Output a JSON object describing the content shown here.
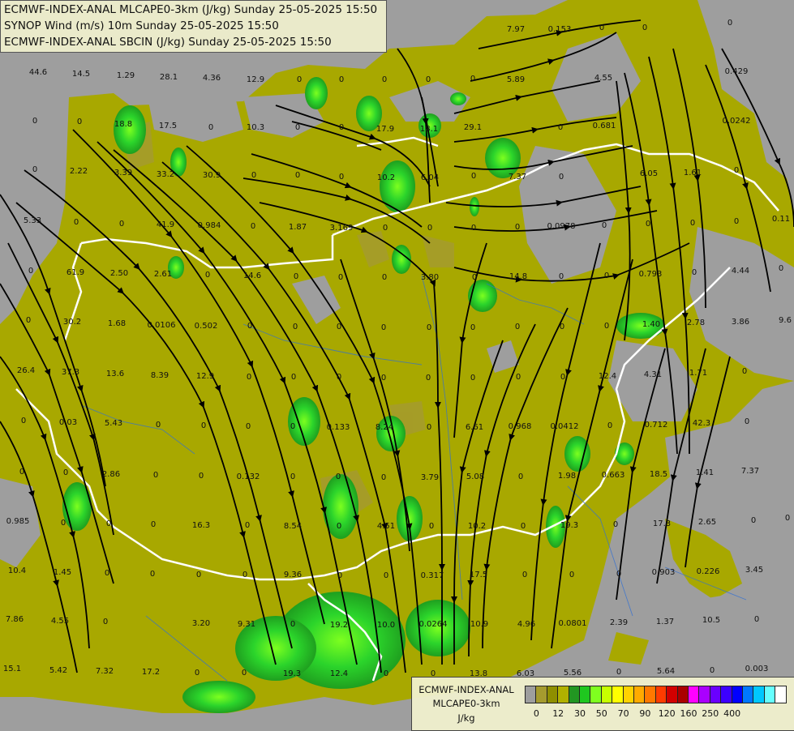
{
  "titles": [
    "ECMWF-INDEX-ANAL MLCAPE0-3km (J/kg) Sunday 25-05-2025 15:50",
    "SYNOP Wind (m/s) 10m Sunday 25-05-2025 15:50",
    "ECMWF-INDEX-ANAL SBCIN (J/kg) Sunday 25-05-2025 15:50"
  ],
  "legend": {
    "line1": "ECMWF-INDEX-ANAL",
    "line2": "MLCAPE0-3km",
    "unit": "J/kg",
    "colors": [
      "#9e9e9e",
      "#a59b2e",
      "#8f8f00",
      "#b1b100",
      "#229622",
      "#1fc71f",
      "#7fff1f",
      "#c7ff00",
      "#ffff00",
      "#ffd200",
      "#ffaa00",
      "#ff7800",
      "#ff3c00",
      "#d20000",
      "#aa0000",
      "#ff00ff",
      "#aa00ff",
      "#6a00ff",
      "#3c00ff",
      "#0000ff",
      "#0078ff",
      "#00c8ff",
      "#66ffff",
      "#ffffff"
    ],
    "ticks": [
      "0",
      "12",
      "30",
      "50",
      "70",
      "90",
      "120",
      "160",
      "250",
      "400"
    ]
  },
  "values": [
    [
      "44.6",
      47,
      92
    ],
    [
      "14.5",
      100,
      94
    ],
    [
      "1.29",
      155,
      96
    ],
    [
      "28.1",
      208,
      98
    ],
    [
      "4.36",
      261,
      99
    ],
    [
      "12.9",
      315,
      101
    ],
    [
      "0",
      369,
      101
    ],
    [
      "0",
      421,
      101
    ],
    [
      "0",
      474,
      101
    ],
    [
      "0",
      528,
      101
    ],
    [
      "0",
      583,
      100
    ],
    [
      "5.89",
      636,
      101
    ],
    [
      "4.55",
      744,
      99
    ],
    [
      "7.97",
      636,
      39
    ],
    [
      "0.153",
      690,
      39
    ],
    [
      "0",
      742,
      37
    ],
    [
      "0",
      795,
      37
    ],
    [
      "0",
      900,
      31
    ],
    [
      "0.429",
      908,
      91
    ],
    [
      "0",
      43,
      152
    ],
    [
      "0",
      98,
      153
    ],
    [
      "18.8",
      152,
      156
    ],
    [
      "17.5",
      207,
      158
    ],
    [
      "0",
      260,
      160
    ],
    [
      "10.3",
      315,
      160
    ],
    [
      "0",
      367,
      160
    ],
    [
      "0",
      421,
      160
    ],
    [
      "17.9",
      475,
      162
    ],
    [
      "18.1",
      529,
      162
    ],
    [
      "29.1",
      583,
      160
    ],
    [
      "0",
      691,
      160
    ],
    [
      "0.681",
      745,
      158
    ],
    [
      "0.0242",
      908,
      152
    ],
    [
      "0",
      43,
      212
    ],
    [
      "2.22",
      97,
      214
    ],
    [
      "3.39",
      152,
      216
    ],
    [
      "33.2",
      204,
      218
    ],
    [
      "30.9",
      261,
      219
    ],
    [
      "0",
      313,
      219
    ],
    [
      "0",
      367,
      219
    ],
    [
      "0",
      421,
      221
    ],
    [
      "10.2",
      476,
      222
    ],
    [
      "6.04",
      530,
      222
    ],
    [
      "0",
      584,
      220
    ],
    [
      "7.37",
      638,
      221
    ],
    [
      "0",
      692,
      221
    ],
    [
      "6.05",
      800,
      217
    ],
    [
      "1.61",
      854,
      216
    ],
    [
      "0",
      908,
      213
    ],
    [
      "5.33",
      40,
      275
    ],
    [
      "0",
      94,
      277
    ],
    [
      "0",
      150,
      279
    ],
    [
      "41.9",
      204,
      280
    ],
    [
      "0.984",
      258,
      281
    ],
    [
      "0",
      312,
      282
    ],
    [
      "1.87",
      367,
      283
    ],
    [
      "3.169",
      421,
      284
    ],
    [
      "0",
      475,
      284
    ],
    [
      "0",
      530,
      284
    ],
    [
      "0",
      584,
      284
    ],
    [
      "0",
      638,
      283
    ],
    [
      "0.0978",
      692,
      282
    ],
    [
      "0",
      745,
      281
    ],
    [
      "0",
      799,
      279
    ],
    [
      "0",
      854,
      278
    ],
    [
      "0",
      908,
      276
    ],
    [
      "0.11",
      963,
      273
    ],
    [
      "0",
      38,
      337
    ],
    [
      "61.9",
      93,
      339
    ],
    [
      "2.50",
      147,
      340
    ],
    [
      "2.61",
      201,
      341
    ],
    [
      "0",
      256,
      342
    ],
    [
      "14.6",
      311,
      343
    ],
    [
      "0",
      365,
      344
    ],
    [
      "0",
      420,
      345
    ],
    [
      "0",
      474,
      345
    ],
    [
      "3.80",
      530,
      345
    ],
    [
      "0",
      585,
      345
    ],
    [
      "14.8",
      639,
      344
    ],
    [
      "0",
      692,
      344
    ],
    [
      "0",
      748,
      343
    ],
    [
      "0.793",
      802,
      341
    ],
    [
      "0",
      856,
      339
    ],
    [
      "4.44",
      913,
      337
    ],
    [
      "0",
      963,
      334
    ],
    [
      "0",
      35,
      398
    ],
    [
      "30.2",
      89,
      400
    ],
    [
      "1.68",
      144,
      402
    ],
    [
      "0.0106",
      199,
      404
    ],
    [
      "0.502",
      254,
      405
    ],
    [
      "0",
      308,
      405
    ],
    [
      "0",
      364,
      406
    ],
    [
      "0",
      418,
      406
    ],
    [
      "0",
      473,
      407
    ],
    [
      "0",
      529,
      407
    ],
    [
      "0",
      583,
      407
    ],
    [
      "0",
      638,
      406
    ],
    [
      "0",
      693,
      406
    ],
    [
      "0",
      748,
      405
    ],
    [
      "1.40",
      803,
      403
    ],
    [
      "2.78",
      858,
      401
    ],
    [
      "3.86",
      913,
      400
    ],
    [
      "9.6",
      968,
      398
    ],
    [
      "26.4",
      32,
      460
    ],
    [
      "37.3",
      87,
      462
    ],
    [
      "13.6",
      142,
      464
    ],
    [
      "8.39",
      197,
      466
    ],
    [
      "12.9",
      253,
      467
    ],
    [
      "0",
      307,
      468
    ],
    [
      "0",
      362,
      468
    ],
    [
      "0",
      418,
      468
    ],
    [
      "0",
      473,
      469
    ],
    [
      "0",
      528,
      469
    ],
    [
      "0",
      583,
      469
    ],
    [
      "0",
      639,
      468
    ],
    [
      "0",
      694,
      468
    ],
    [
      "12.4",
      749,
      467
    ],
    [
      "4.31",
      805,
      465
    ],
    [
      "1.71",
      861,
      463
    ],
    [
      "0",
      918,
      461
    ],
    [
      "0",
      29,
      522
    ],
    [
      "0.03",
      84,
      524
    ],
    [
      "5.43",
      140,
      525
    ],
    [
      "0",
      195,
      527
    ],
    [
      "0",
      251,
      528
    ],
    [
      "0",
      306,
      529
    ],
    [
      "0",
      361,
      529
    ],
    [
      "0.133",
      417,
      530
    ],
    [
      "8.24",
      474,
      530
    ],
    [
      "0",
      529,
      530
    ],
    [
      "6.61",
      585,
      530
    ],
    [
      "0.968",
      641,
      529
    ],
    [
      "0.0412",
      696,
      529
    ],
    [
      "0",
      752,
      528
    ],
    [
      "0.712",
      809,
      527
    ],
    [
      "42.3",
      865,
      525
    ],
    [
      "0",
      921,
      523
    ],
    [
      "0",
      27,
      585
    ],
    [
      "0",
      81,
      586
    ],
    [
      "2.86",
      137,
      588
    ],
    [
      "0",
      192,
      589
    ],
    [
      "0",
      248,
      590
    ],
    [
      "0.132",
      306,
      591
    ],
    [
      "0",
      361,
      591
    ],
    [
      "0",
      417,
      591
    ],
    [
      "0",
      473,
      592
    ],
    [
      "3.79",
      530,
      592
    ],
    [
      "5.08",
      586,
      591
    ],
    [
      "0",
      642,
      591
    ],
    [
      "1.98",
      699,
      590
    ],
    [
      "0.663",
      756,
      589
    ],
    [
      "18.5",
      812,
      588
    ],
    [
      "1.41",
      869,
      586
    ],
    [
      "7.37",
      925,
      584
    ],
    [
      "0.985",
      22,
      646
    ],
    [
      "0",
      78,
      648
    ],
    [
      "0",
      134,
      649
    ],
    [
      "0",
      189,
      650
    ],
    [
      "16.3",
      248,
      651
    ],
    [
      "0",
      305,
      651
    ],
    [
      "8.54",
      361,
      652
    ],
    [
      "0",
      418,
      652
    ],
    [
      "4.51",
      476,
      652
    ],
    [
      "0",
      532,
      652
    ],
    [
      "10.2",
      588,
      652
    ],
    [
      "0",
      645,
      652
    ],
    [
      "19.3",
      702,
      651
    ],
    [
      "0",
      759,
      650
    ],
    [
      "17.3",
      816,
      649
    ],
    [
      "2.65",
      872,
      647
    ],
    [
      "0",
      929,
      645
    ],
    [
      "0",
      971,
      642
    ],
    [
      "10.4",
      21,
      707
    ],
    [
      "1.45",
      77,
      709
    ],
    [
      "0",
      132,
      710
    ],
    [
      "0",
      188,
      711
    ],
    [
      "0",
      245,
      712
    ],
    [
      "0",
      302,
      712
    ],
    [
      "9.36",
      361,
      712
    ],
    [
      "0",
      419,
      713
    ],
    [
      "0",
      476,
      713
    ],
    [
      "0.317",
      533,
      713
    ],
    [
      "17.5",
      590,
      712
    ],
    [
      "0",
      647,
      712
    ],
    [
      "0",
      705,
      712
    ],
    [
      "0",
      763,
      711
    ],
    [
      "0.903",
      818,
      709
    ],
    [
      "0.226",
      873,
      708
    ],
    [
      "3.45",
      930,
      706
    ],
    [
      "7.86",
      18,
      767
    ],
    [
      "4.55",
      74,
      769
    ],
    [
      "0",
      130,
      770
    ],
    [
      "3.20",
      248,
      772
    ],
    [
      "9.31",
      304,
      773
    ],
    [
      "0",
      361,
      773
    ],
    [
      "19.2",
      418,
      774
    ],
    [
      "10.0",
      476,
      774
    ],
    [
      "0.0264",
      534,
      773
    ],
    [
      "10.9",
      591,
      773
    ],
    [
      "4.96",
      649,
      773
    ],
    [
      "0.0801",
      706,
      772
    ],
    [
      "2.39",
      763,
      771
    ],
    [
      "1.37",
      820,
      770
    ],
    [
      "10.5",
      877,
      768
    ],
    [
      "0",
      933,
      767
    ],
    [
      "15.1",
      15,
      828
    ],
    [
      "5.42",
      72,
      830
    ],
    [
      "7.32",
      129,
      831
    ],
    [
      "17.2",
      186,
      832
    ],
    [
      "0",
      243,
      833
    ],
    [
      "0",
      301,
      833
    ],
    [
      "19.3",
      360,
      834
    ],
    [
      "12.4",
      418,
      834
    ],
    [
      "0",
      476,
      834
    ],
    [
      "0",
      534,
      834
    ],
    [
      "13.8",
      590,
      834
    ],
    [
      "6.03",
      648,
      834
    ],
    [
      "5.56",
      706,
      833
    ],
    [
      "0",
      763,
      832
    ],
    [
      "5.64",
      821,
      831
    ],
    [
      "0",
      878,
      830
    ],
    [
      "0.003",
      933,
      828
    ]
  ]
}
